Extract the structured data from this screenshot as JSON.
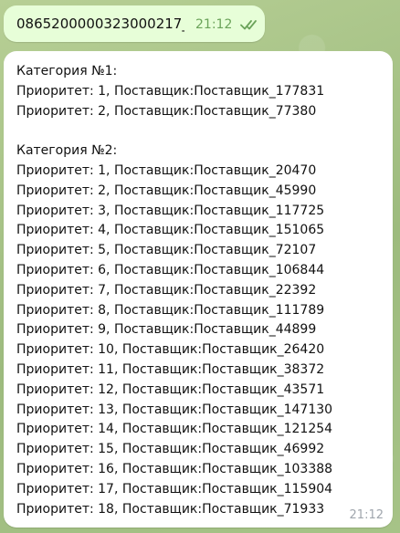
{
  "outgoing_message": {
    "text": "0865200000323000217_",
    "time": "21:12",
    "status_icon": "double-check-icon",
    "accent_color": "#6ba35a"
  },
  "incoming_message": {
    "time": "21:12",
    "lines": [
      "Категория №1:",
      "Приоритет: 1, Поставщик:Поставщик_177831",
      "Приоритет: 2, Поставщик:Поставщик_77380",
      "",
      "Категория №2:",
      "Приоритет: 1, Поставщик:Поставщик_20470",
      "Приоритет: 2, Поставщик:Поставщик_45990",
      "Приоритет: 3, Поставщик:Поставщик_117725",
      "Приоритет: 4, Поставщик:Поставщик_151065",
      "Приоритет: 5, Поставщик:Поставщик_72107",
      "Приоритет: 6, Поставщик:Поставщик_106844",
      "Приоритет: 7, Поставщик:Поставщик_22392",
      "Приоритет: 8, Поставщик:Поставщик_111789",
      "Приоритет: 9, Поставщик:Поставщик_44899",
      "Приоритет: 10, Поставщик:Поставщик_26420",
      "Приоритет: 11, Поставщик:Поставщик_38372",
      "Приоритет: 12, Поставщик:Поставщик_43571",
      "Приоритет: 13, Поставщик:Поставщик_147130",
      "Приоритет: 14, Поставщик:Поставщик_121254",
      "Приоритет: 15, Поставщик:Поставщик_46992",
      "Приоритет: 16, Поставщик:Поставщик_103388",
      "Приоритет: 17, Поставщик:Поставщик_115904",
      "Приоритет: 18, Поставщик:Поставщик_71933"
    ]
  },
  "colors": {
    "chat_background": "#a9c48a",
    "outgoing_bubble": "#e7fed8",
    "incoming_bubble": "#ffffff"
  }
}
